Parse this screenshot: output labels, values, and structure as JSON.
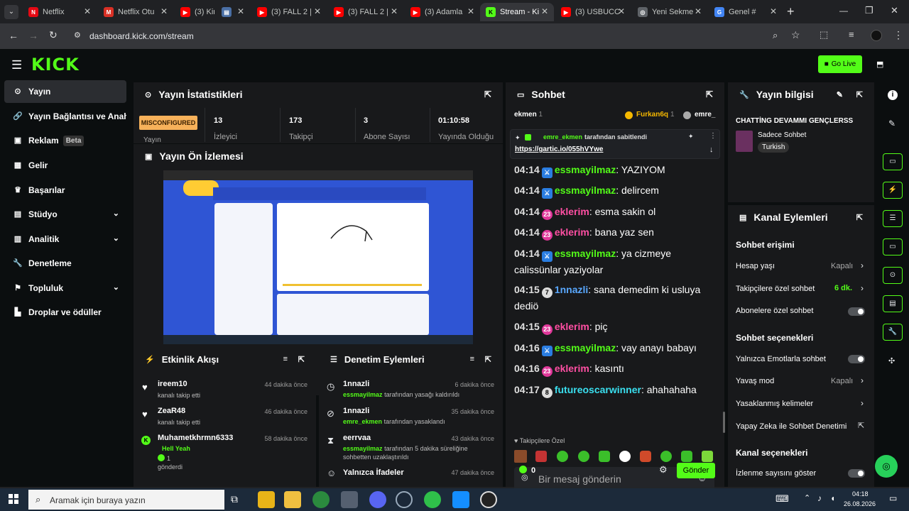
{
  "browser": {
    "tabs": [
      {
        "label": "Netflix",
        "icon": "N",
        "color": "#e50914"
      },
      {
        "label": "Netflix Otu",
        "icon": "M",
        "color": "#d93025"
      },
      {
        "label": "(3) Kim",
        "icon": "▶",
        "color": "#ff0000"
      },
      {
        "label": "",
        "icon": "▤",
        "color": "#4a6fa5"
      },
      {
        "label": "(3) FALL 2 |",
        "icon": "▶",
        "color": "#ff0000"
      },
      {
        "label": "(3) FALL 2 |",
        "icon": "▶",
        "color": "#ff0000"
      },
      {
        "label": "(3) Adamla",
        "icon": "▶",
        "color": "#ff0000"
      },
      {
        "label": "Stream - Ki",
        "icon": "K",
        "color": "#53fc18"
      },
      {
        "label": "(3) USBUCC",
        "icon": "▶",
        "color": "#ff0000"
      },
      {
        "label": "Yeni Sekme",
        "icon": "◎",
        "color": "#5f6368"
      },
      {
        "label": "Genel #",
        "icon": "G",
        "color": "#4285f4"
      }
    ],
    "url": "dashboard.kick.com/stream",
    "new_tab": "+"
  },
  "header": {
    "logo": "KICK",
    "go_live": "Go Live"
  },
  "sidebar": {
    "items": [
      {
        "label": "Yayın",
        "icon": "((•))",
        "active": true
      },
      {
        "label": "Yayın Bağlantısı ve Anahta",
        "icon": "🔗"
      },
      {
        "label": "Reklam",
        "icon": "▣",
        "badge": "Beta"
      },
      {
        "label": "Gelir",
        "icon": "▦"
      },
      {
        "label": "Başarılar",
        "icon": "🏆"
      },
      {
        "label": "Stüdyo",
        "icon": "▤",
        "chevron": true
      },
      {
        "label": "Analitik",
        "icon": "▥",
        "chevron": true
      },
      {
        "label": "Denetleme",
        "icon": "🔧"
      },
      {
        "label": "Topluluk",
        "icon": "⚑",
        "chevron": true
      },
      {
        "label": "Droplar ve ödüller",
        "icon": "▙"
      }
    ]
  },
  "stats": {
    "title": "Yayın İstatistikleri",
    "status": "MISCONFIGURED",
    "status_sub": "Yayın",
    "items": [
      {
        "value": "13",
        "label": "İzleyici"
      },
      {
        "value": "173",
        "label": "Takipçi"
      },
      {
        "value": "3",
        "label": "Abone Sayısı"
      },
      {
        "value": "01:10:58",
        "label": "Yayında Olduğu"
      }
    ]
  },
  "preview": {
    "title": "Yayın Ön İzlemesi"
  },
  "activity": {
    "title": "Etkinlik Akışı",
    "events": [
      {
        "name": "ireem10",
        "sub": "kanalı takip etti",
        "time": "44 dakika önce"
      },
      {
        "name": "ZeaR48",
        "sub": "kanalı takip etti",
        "time": "46 dakika önce"
      },
      {
        "name": "Muhametkhrmn6333",
        "extra": "Hell Yeah",
        "count": "1",
        "sub": "gönderdi",
        "time": "58 dakika önce"
      }
    ]
  },
  "moderation": {
    "title": "Denetim Eylemleri",
    "events": [
      {
        "name": "1nnazli",
        "actor": "essmayilmaz",
        "sub": "tarafından yasağı kaldırıldı",
        "time": "6 dakika önce"
      },
      {
        "name": "1nnazli",
        "actor": "emre_ekmen",
        "sub": "tarafından yasaklandı",
        "time": "35 dakika önce"
      },
      {
        "name": "eerrvaa",
        "actor": "essmayilmaz",
        "sub": "tarafından 5 dakika süreliğine sohbetten uzaklaştırıldı",
        "time": "43 dakika önce"
      },
      {
        "name": "Yalnızca İfadeler",
        "time": "47 dakika önce"
      }
    ]
  },
  "chat": {
    "title": "Sohbet",
    "top_users": [
      {
        "name": "ekmen",
        "count": "1"
      },
      {
        "name": "Furkan6q",
        "count": "1"
      },
      {
        "name": "emre_"
      }
    ],
    "pinned": {
      "by": "emre_ekmen",
      "suffix": "tarafından sabitlendi",
      "link": "https://gartic.io/055hVYwe"
    },
    "messages": [
      {
        "time": "04:14",
        "user": "essmayilmaz",
        "color": "#53fc18",
        "badge": "sword",
        "text": "YAZIYOM"
      },
      {
        "time": "04:14",
        "user": "essmayilmaz",
        "color": "#53fc18",
        "badge": "sword",
        "text": "delircem"
      },
      {
        "time": "04:14",
        "user": "eklerim",
        "color": "#ff4fa3",
        "badge": "23",
        "text": "esma sakin ol"
      },
      {
        "time": "04:14",
        "user": "eklerim",
        "color": "#ff4fa3",
        "badge": "23",
        "text": "bana yaz sen"
      },
      {
        "time": "04:14",
        "user": "essmayilmaz",
        "color": "#53fc18",
        "badge": "sword",
        "text": "ya cizmeye calissünlar yaziyolar"
      },
      {
        "time": "04:15",
        "user": "1nnazli",
        "color": "#59a8ff",
        "badge": "7",
        "text": "sana demedim ki usluya dediö"
      },
      {
        "time": "04:15",
        "user": "eklerim",
        "color": "#ff4fa3",
        "badge": "23",
        "text": "piç"
      },
      {
        "time": "04:16",
        "user": "essmayilmaz",
        "color": "#53fc18",
        "badge": "sword",
        "text": "vay anayı babayı"
      },
      {
        "time": "04:16",
        "user": "eklerim",
        "color": "#ff4fa3",
        "badge": "23",
        "text": "kasıntı"
      },
      {
        "time": "04:17",
        "user": "futureoscarwinner",
        "color": "#3ae0f0",
        "badge": "8",
        "text": "ahahahaha"
      }
    ],
    "followers_only": "Takipçilere Özel",
    "placeholder": "Bir mesaj gönderin",
    "points": "0",
    "send": "Gönder"
  },
  "stream_info": {
    "title": "Yayın bilgisi",
    "stream_title": "CHATTİNG DEVAMMI GENÇLERSS",
    "category": "Sadece Sohbet",
    "tag": "Turkish"
  },
  "channel_actions": {
    "title": "Kanal Eylemleri",
    "chat_access": "Sohbet erişimi",
    "account_age": "Hesap yaşı",
    "account_age_val": "Kapalı",
    "followers_only": "Takipçilere özel sohbet",
    "followers_only_val": "6 dk.",
    "subs_only": "Abonelere özel sohbet",
    "chat_options": "Sohbet seçenekleri",
    "emotes_only": "Yalnızca Emotlarla sohbet",
    "slow_mode": "Yavaş mod",
    "slow_mode_val": "Kapalı",
    "banned_words": "Yasaklanmış kelimeler",
    "ai_mod": "Yapay Zeka ile Sohbet Denetimi",
    "channel_options": "Kanal seçenekleri",
    "show_viewers": "İzlenme sayısını göster"
  },
  "taskbar": {
    "search": "Aramak için buraya yazın",
    "time": "04:18",
    "date": "26.08.2026"
  }
}
